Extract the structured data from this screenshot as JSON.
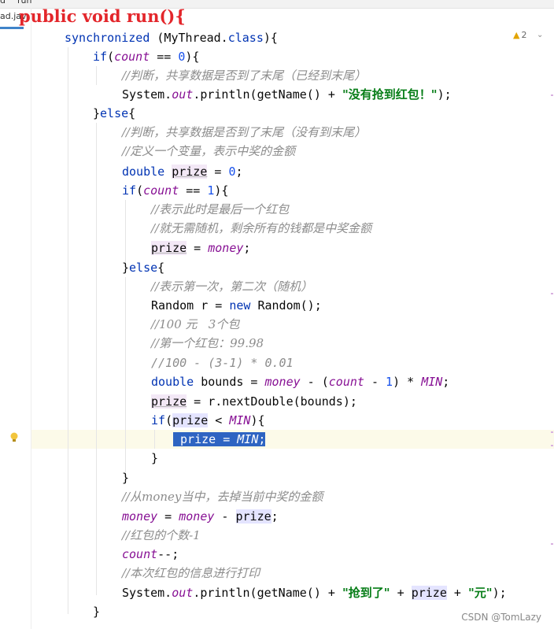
{
  "tabs": {
    "left_label": "d",
    "breadcrumb_label": "run",
    "file_label": "ad.jav"
  },
  "overlay_title": "public void run(){",
  "editor": {
    "inspection_count": "2",
    "lines": [
      "synchronized (MyThread.class){",
      "if(count == 0){",
      "//判断，共享数据是否到了末尾（已经到末尾）",
      "System.out.println(getName() + \"没有抢到红包！\");",
      "}else{",
      "//判断，共享数据是否到了末尾（没有到末尾）",
      "//定义一个变量，表示中奖的金额",
      "double prize = 0;",
      "if(count == 1){",
      "//表示此时是最后一个红包",
      "//就无需随机，剩余所有的钱都是中奖金额",
      "prize = money;",
      "}else{",
      "//表示第一次，第二次（随机）",
      "Random r = new Random();",
      "//100 元   3个包",
      "//第一个红包：99.98",
      "//100 - (3-1) * 0.01",
      "double bounds = money - (count - 1) * MIN;",
      "prize = r.nextDouble(bounds);",
      "if(prize < MIN){",
      "prize = MIN;",
      "}",
      "}",
      "//从money当中，去掉当前中奖的金额",
      "money = money - prize;",
      "//红包的个数-1",
      "count--;",
      "//本次红包的信息进行打印",
      "System.out.println(getName() + \"抢到了\" + prize + \"元\");",
      "}"
    ]
  },
  "watermark": "CSDN @TomLazy",
  "colors": {
    "keyword": "#0033b3",
    "string": "#067d17",
    "number": "#1750eb",
    "field": "#871094",
    "comment": "#8c8c8c",
    "selection": "#2e64c2",
    "overlay_title": "#e3262b"
  }
}
